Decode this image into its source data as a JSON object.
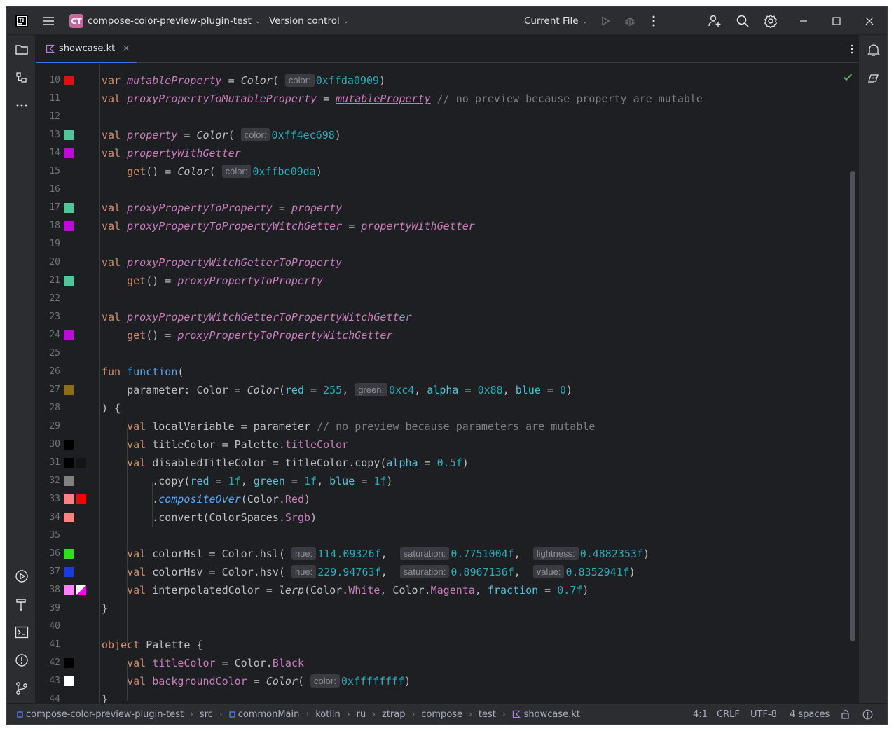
{
  "titlebar": {
    "project_initials": "CT",
    "project_name": "compose-color-preview-plugin-test",
    "vcs_label": "Version control",
    "run_config": "Current File"
  },
  "tab": {
    "filename": "showcase.kt",
    "close_glyph": "×"
  },
  "editor": {
    "lines": [
      {
        "n": "10",
        "sw": [
          "#e01010"
        ]
      },
      {
        "n": "11",
        "sw": []
      },
      {
        "n": "12",
        "sw": []
      },
      {
        "n": "13",
        "sw": [
          "#4ec698"
        ]
      },
      {
        "n": "14",
        "sw": [
          "#be09da"
        ]
      },
      {
        "n": "15",
        "sw": []
      },
      {
        "n": "16",
        "sw": []
      },
      {
        "n": "17",
        "sw": [
          "#4ec698"
        ]
      },
      {
        "n": "18",
        "sw": [
          "#be09da"
        ]
      },
      {
        "n": "19",
        "sw": []
      },
      {
        "n": "20",
        "sw": []
      },
      {
        "n": "21",
        "sw": [
          "#4ec698"
        ]
      },
      {
        "n": "22",
        "sw": []
      },
      {
        "n": "23",
        "sw": []
      },
      {
        "n": "24",
        "sw": [
          "#be09da"
        ]
      },
      {
        "n": "25",
        "sw": []
      },
      {
        "n": "26",
        "sw": []
      },
      {
        "n": "27",
        "sw": [
          "#8c6e14"
        ]
      },
      {
        "n": "28",
        "sw": []
      },
      {
        "n": "29",
        "sw": []
      },
      {
        "n": "30",
        "sw": [
          "#000000"
        ]
      },
      {
        "n": "31",
        "sw": [
          "#000000",
          "#141414"
        ]
      },
      {
        "n": "32",
        "sw": [
          "#808080"
        ]
      },
      {
        "n": "33",
        "sw": [
          "#ff8080",
          "#ff0000"
        ]
      },
      {
        "n": "34",
        "sw": [
          "#ff8080"
        ]
      },
      {
        "n": "35",
        "sw": []
      },
      {
        "n": "36",
        "sw": [
          "#2ee01c"
        ]
      },
      {
        "n": "37",
        "sw": [
          "#1a3be0"
        ]
      },
      {
        "n": "38",
        "sw": [
          "#ff80ff",
          "split"
        ]
      },
      {
        "n": "39",
        "sw": []
      },
      {
        "n": "40",
        "sw": []
      },
      {
        "n": "41",
        "sw": []
      },
      {
        "n": "42",
        "sw": [
          "#000000"
        ]
      },
      {
        "n": "43",
        "sw": [
          "#ffffff"
        ]
      },
      {
        "n": "44",
        "sw": []
      }
    ]
  },
  "statusbar": {
    "breadcrumbs": [
      "compose-color-preview-plugin-test",
      "src",
      "commonMain",
      "kotlin",
      "ru",
      "ztrap",
      "compose",
      "test",
      "showcase.kt"
    ],
    "position": "4:1",
    "line_separator": "CRLF",
    "encoding": "UTF-8",
    "indent": "4 spaces"
  },
  "colors": {
    "accent": "#3574f0",
    "editor_bg": "#1e1f22",
    "chrome_bg": "#2b2d30",
    "keyword": "#cf8e6d",
    "property": "#c77dbb",
    "number": "#2aacb8",
    "comment": "#7a7e85",
    "function_decl": "#56a8f5"
  },
  "icons": [
    "app-icon",
    "hamburger-menu-icon",
    "run-icon",
    "debug-icon",
    "more-vertical-icon",
    "add-user-icon",
    "search-icon",
    "settings-icon",
    "minimize-icon",
    "maximize-icon",
    "close-icon",
    "project-folder-icon",
    "structure-icon",
    "more-horizontal-icon",
    "run-tool-icon",
    "build-icon",
    "terminal-icon",
    "problems-icon",
    "git-icon",
    "notifications-icon",
    "ai-assistant-icon",
    "check-icon",
    "kotlin-file-icon",
    "module-icon",
    "lock-icon",
    "warning-icon"
  ]
}
